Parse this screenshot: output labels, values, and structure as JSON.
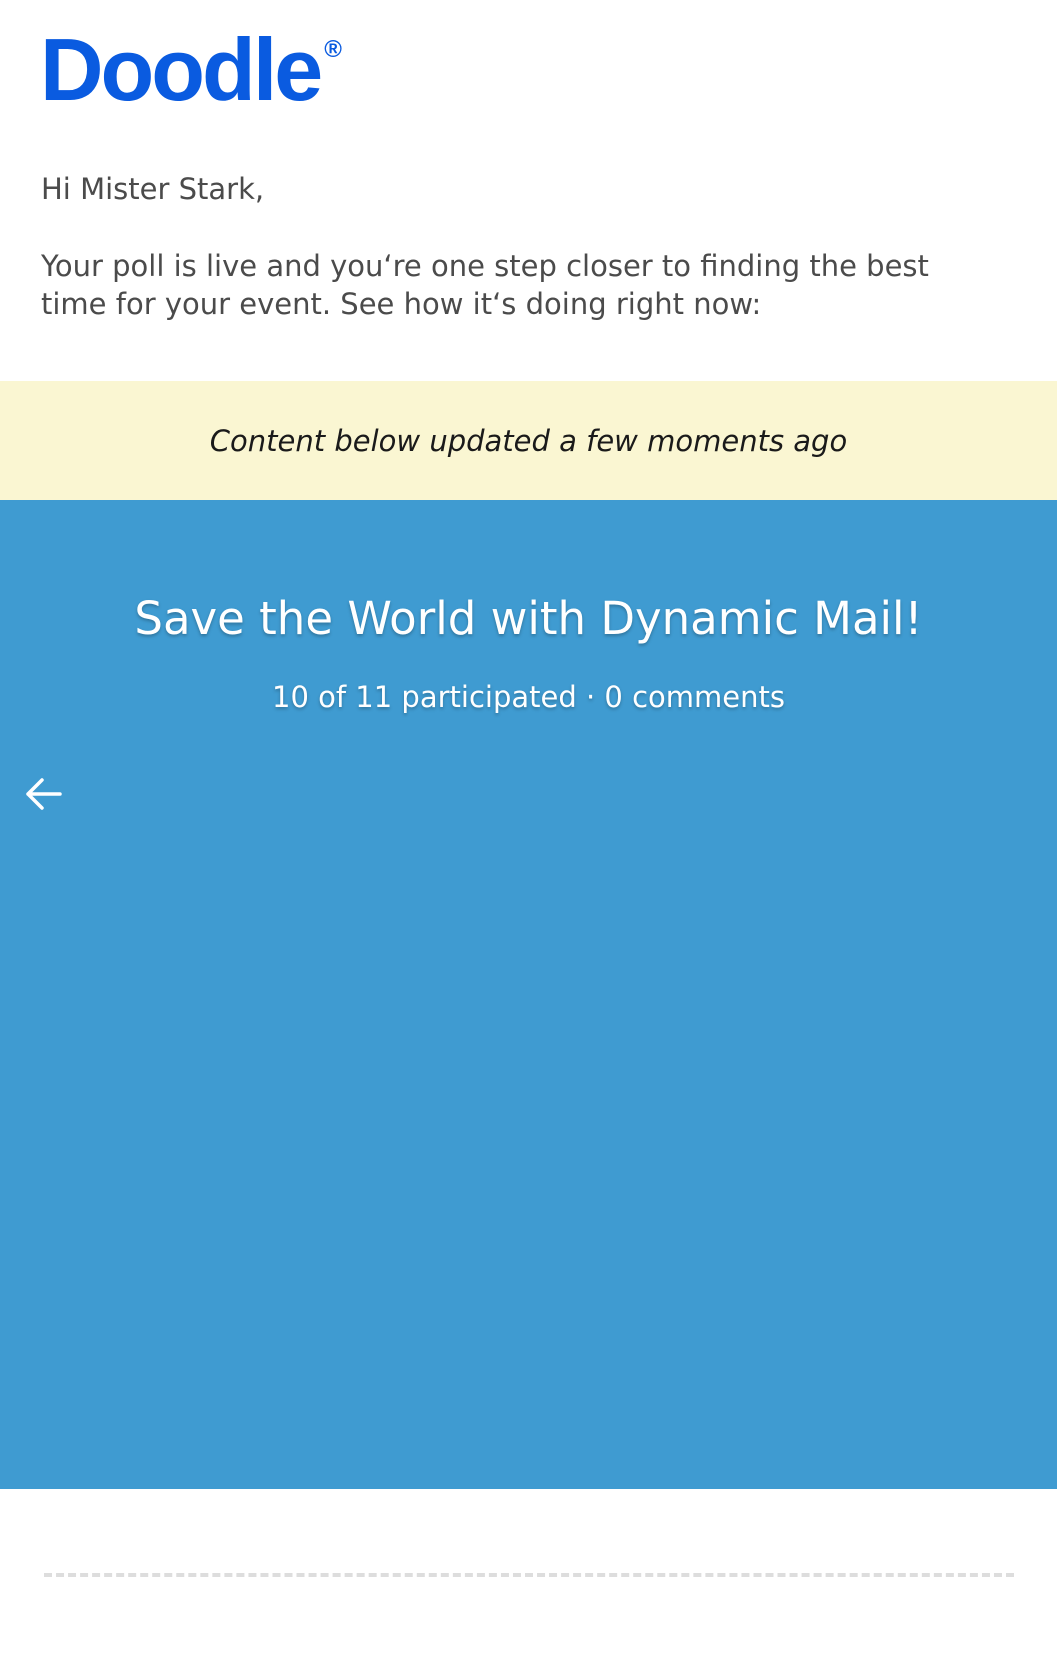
{
  "logo": {
    "text": "Doodle",
    "registered": "®",
    "color": "#0a5be0"
  },
  "email": {
    "greeting": "Hi Mister Stark,",
    "intro": "Your poll is live and you‘re one step closer to finding the best time for your event. See how it‘s doing right now:"
  },
  "update_banner": {
    "text": "Content below updated a few moments ago",
    "background": "#faf6d2"
  },
  "poll": {
    "title": "Save the World with Dynamic Mail!",
    "stats": "10 of 11 participated · 0 comments",
    "background": "#3f9bd1",
    "nav_icon": "arrow-left-icon"
  }
}
